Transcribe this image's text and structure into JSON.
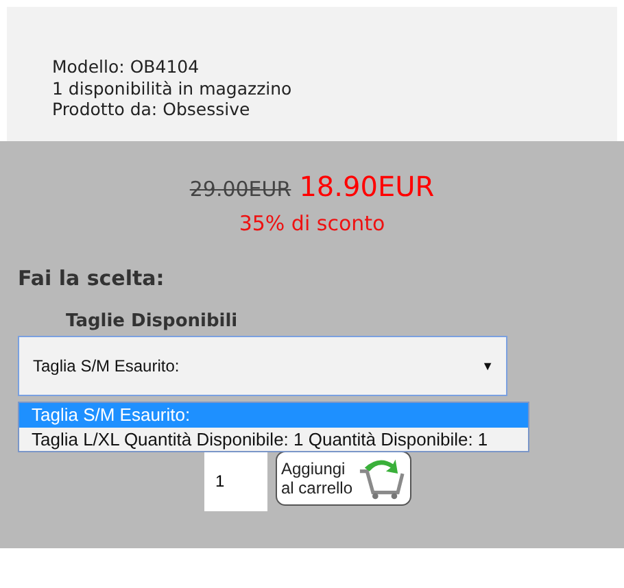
{
  "product_info": [
    "Modello: OB4104",
    "1 disponibilità in magazzino",
    "Prodotto da: Obsessive"
  ],
  "price": {
    "old": "29.00EUR",
    "new": "18.90EUR",
    "discount": "35% di sconto"
  },
  "choice_heading": "Fai la scelta:",
  "size_label": "Taglie Disponibili",
  "size_select": {
    "value": "Taglia S/M Esaurito:",
    "arrow": "▼",
    "expanded": true
  },
  "size_options": [
    {
      "label": "Taglia S/M Esaurito:",
      "selected": true
    },
    {
      "label": "Taglia L/XL Quantità Disponibile: 1 Quantità Disponibile: 1",
      "selected": false
    }
  ],
  "quantity": {
    "value": "1"
  },
  "add_to_cart": {
    "lines": [
      "Aggiungi",
      "al carrello"
    ]
  }
}
